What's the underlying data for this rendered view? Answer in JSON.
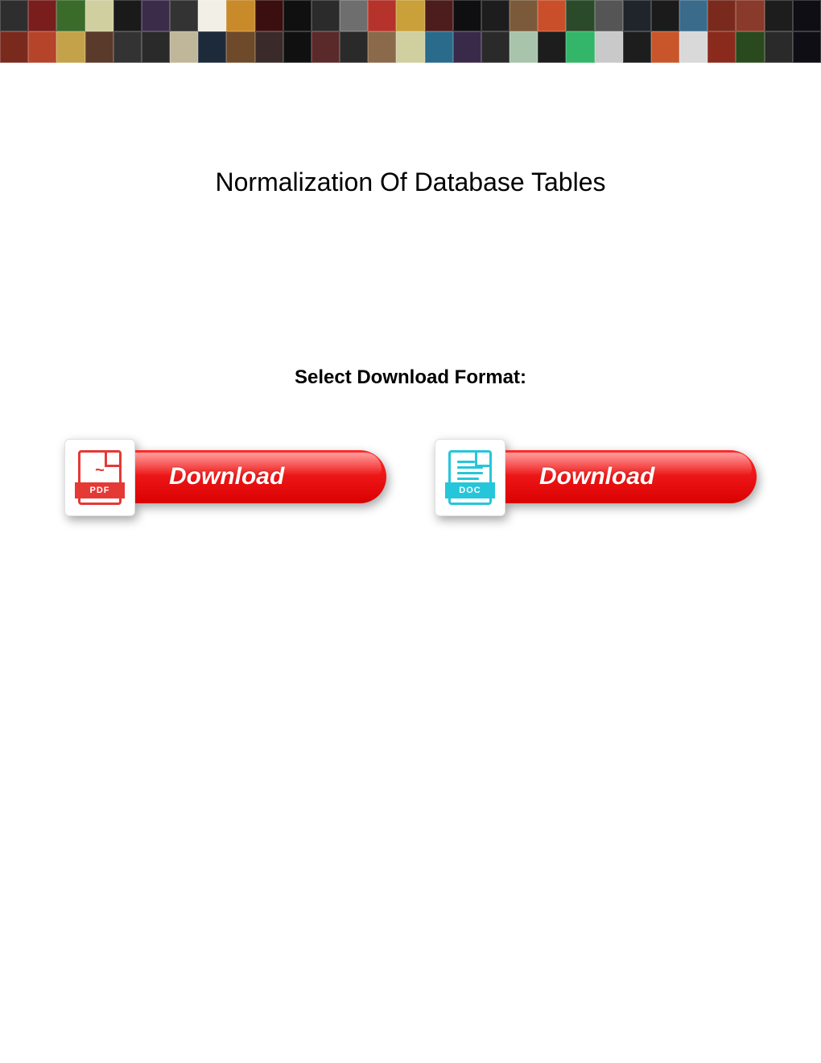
{
  "banner": {
    "tile_colors_row1": [
      "#2e2e2e",
      "#7a1d1d",
      "#3a6b2a",
      "#d0cfa0",
      "#1a1a1a",
      "#3b2d4a",
      "#333333",
      "#f2efe6",
      "#c98a2a",
      "#3b0f0f",
      "#101010",
      "#2b2b2b",
      "#6e6e6e",
      "#b5332a",
      "#c9a03a",
      "#4d1d1d",
      "#0f0f12",
      "#1d1d1d",
      "#7a5a3a",
      "#c94f2a",
      "#2b4a2a",
      "#555555",
      "#20252b",
      "#1b1b1b",
      "#3b6b8a",
      "#7a2a1d",
      "#8a3a2a",
      "#1d1d1d",
      "#0e0e14"
    ],
    "tile_colors_row2": [
      "#7a2a1d",
      "#b5442a",
      "#c4a24a",
      "#5a3a2a",
      "#333333",
      "#2a2a2a",
      "#c0b69a",
      "#1d2a3a",
      "#6e4a2a",
      "#3a2a2a",
      "#101010",
      "#5a2a2a",
      "#2a2a2a",
      "#8a6a4a",
      "#d0cfa0",
      "#2a6a8a",
      "#3a2a4a",
      "#2a2a2a",
      "#a8c4aa",
      "#1d1d1d",
      "#33b56a",
      "#c9c9c9",
      "#1d1d1d",
      "#c9552a",
      "#d9d9d9",
      "#8a2a1d",
      "#2a4a1d",
      "#2a2a2a",
      "#0e0e14"
    ]
  },
  "title": "Normalization Of Database Tables",
  "select_label": "Select Download Format:",
  "buttons": {
    "pdf": {
      "label": "Download",
      "badge_text": "PDF"
    },
    "doc": {
      "label": "Download",
      "badge_text": "DOC"
    }
  }
}
